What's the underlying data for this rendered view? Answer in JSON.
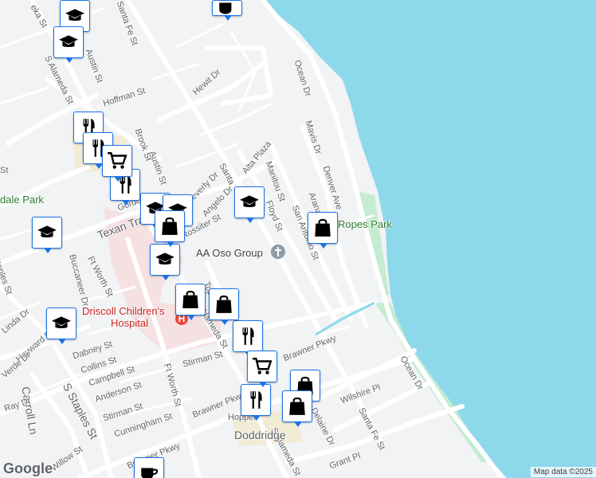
{
  "map": {
    "attribution": "Map data ©2025",
    "logo": "Google",
    "colors": {
      "water": "#8ed8ec",
      "park": "#c3ecd1",
      "land": "#f1f3f4",
      "road": "#ffffff",
      "poi_border": "#1a73e8"
    }
  },
  "places": {
    "park_left": "dale Park",
    "park_ropes": "Ropes Park",
    "church": "AA Oso Group",
    "hospital_line1": "Driscoll Children's",
    "hospital_line2": "Hospital"
  },
  "streets": {
    "ocean_dr_north": "Ocean Dr",
    "ocean_dr_south": "Ocean Dr",
    "santa_fe_north": "Santa Fe St",
    "santa_fe_mid": "Santa",
    "santa_fe_south": "Santa Fe St",
    "alameda_north": "S Alameda St",
    "alameda_mid": "Alameda St",
    "alameda_south": "S Alameda St",
    "austin_north": "Austin St",
    "austin_mid": "Austin St",
    "hoffman": "Hoffman St",
    "hewit": "Hewit Dr",
    "ocean_st": "Ocean Dr",
    "mavis": "Mavis Dr",
    "denver": "Denver Ave",
    "manitou": "Manitou St",
    "alta_plaza": "Alta Plaza",
    "floyd": "Floyd St",
    "arana": "Arana",
    "san_antonio": "San Antonio St",
    "texan_trail": "Texan Trail",
    "gordon": "Gordon",
    "beverly": "Beverly Dr",
    "angelo": "Angelo Dr",
    "rossiter": "Rossiter St",
    "topeka_mid": "Topeka St",
    "ft_worth_north": "Ft Worth St",
    "ft_worth_south": "Ft Worth St",
    "buccaneer": "Buccaneer Dr",
    "dabney": "Dabney St",
    "collins": "Collins St",
    "campbell": "Campbell St",
    "anderson": "Anderson St",
    "stirman_w": "Stirman St",
    "stirman_e": "Stirman St",
    "cunningham": "Cunningham St",
    "brawner_w": "Brawner Pkwy",
    "brawner_mid": "Brawner Pkwy",
    "brawner_e": "Brawner Pkwy",
    "hopper": "Hopper",
    "doddridge": "Doddridge",
    "delaine": "Delaine Dr",
    "wilshire": "Wilshire Pl",
    "grant": "Grant Pl",
    "carroll": "Carroll Ln",
    "staples_s": "S Staples St",
    "staples_n": "Staples St",
    "ray": "Ray Dr",
    "hayward": "Hayward Dr",
    "linda": "Linda Dr",
    "verde": "Verde Dr",
    "willow": "Willow St",
    "edge_st": "St",
    "kw_st": "eka St",
    "brook": "Brook St"
  },
  "markers": [
    {
      "name": "school-marker-1",
      "icon": "school-icon"
    },
    {
      "name": "school-marker-2",
      "icon": "school-icon"
    },
    {
      "name": "school-marker-3",
      "icon": "school-icon"
    },
    {
      "name": "school-marker-4",
      "icon": "school-icon"
    },
    {
      "name": "school-marker-5",
      "icon": "school-icon"
    },
    {
      "name": "school-marker-6",
      "icon": "school-icon"
    },
    {
      "name": "school-marker-7",
      "icon": "school-icon"
    },
    {
      "name": "school-marker-8",
      "icon": "school-icon"
    },
    {
      "name": "restaurant-marker-1",
      "icon": "restaurant-icon"
    },
    {
      "name": "restaurant-marker-2",
      "icon": "restaurant-icon"
    },
    {
      "name": "restaurant-marker-3",
      "icon": "restaurant-icon"
    },
    {
      "name": "restaurant-marker-4",
      "icon": "restaurant-icon"
    },
    {
      "name": "restaurant-marker-5",
      "icon": "restaurant-icon"
    },
    {
      "name": "cart-marker-1",
      "icon": "shopping-cart-icon"
    },
    {
      "name": "cart-marker-2",
      "icon": "shopping-cart-icon"
    },
    {
      "name": "bag-marker-1",
      "icon": "shopping-bag-icon"
    },
    {
      "name": "bag-marker-2",
      "icon": "shopping-bag-icon"
    },
    {
      "name": "bag-marker-3",
      "icon": "shopping-bag-icon"
    },
    {
      "name": "bag-marker-4",
      "icon": "shopping-bag-icon"
    },
    {
      "name": "bag-marker-5",
      "icon": "shopping-bag-icon"
    },
    {
      "name": "bag-marker-6",
      "icon": "shopping-bag-icon"
    },
    {
      "name": "cafe-marker-1",
      "icon": "coffee-cup-icon"
    }
  ]
}
